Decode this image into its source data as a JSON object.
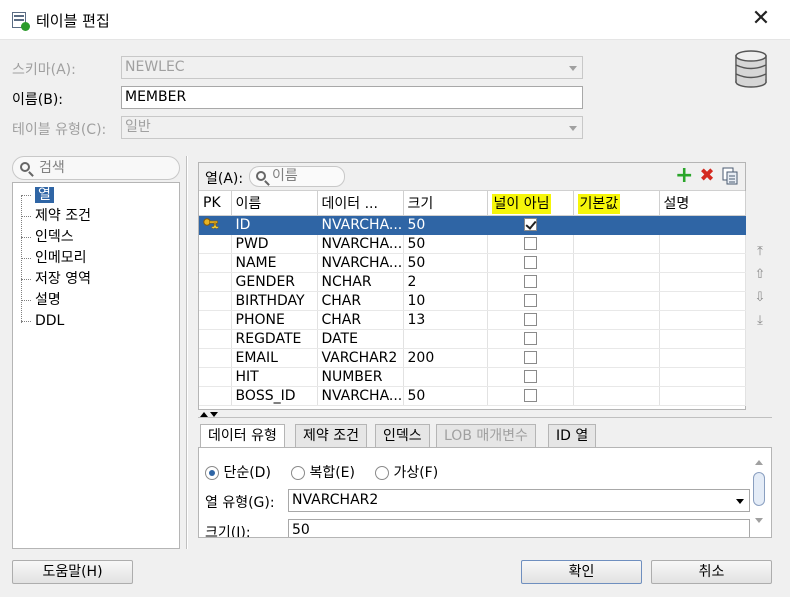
{
  "window": {
    "title": "테이블 편집"
  },
  "form": {
    "schema_label": "스키마(A):",
    "schema_value": "NEWLEC",
    "name_label": "이름(B):",
    "name_value": "MEMBER",
    "table_type_label": "테이블 유형(C):",
    "table_type_value": "일반"
  },
  "nav": {
    "search_placeholder": "검색",
    "items": [
      "열",
      "제약 조건",
      "인덱스",
      "인메모리",
      "저장 영역",
      "설명",
      "DDL"
    ],
    "selected": "열"
  },
  "columns_panel": {
    "label": "열(A):",
    "search_placeholder": "이름",
    "headers": [
      "PK",
      "이름",
      "데이터 ...",
      "크기",
      "널이 아님",
      "기본값",
      "설명"
    ],
    "highlighted_headers": [
      "널이 아님",
      "기본값"
    ],
    "rows": [
      {
        "pk": true,
        "name": "ID",
        "type": "NVARCHA...",
        "size": "50",
        "not_null": true,
        "default": "",
        "comment": ""
      },
      {
        "pk": false,
        "name": "PWD",
        "type": "NVARCHA...",
        "size": "50",
        "not_null": false,
        "default": "",
        "comment": ""
      },
      {
        "pk": false,
        "name": "NAME",
        "type": "NVARCHA...",
        "size": "50",
        "not_null": false,
        "default": "",
        "comment": ""
      },
      {
        "pk": false,
        "name": "GENDER",
        "type": "NCHAR",
        "size": "2",
        "not_null": false,
        "default": "",
        "comment": ""
      },
      {
        "pk": false,
        "name": "BIRTHDAY",
        "type": "CHAR",
        "size": "10",
        "not_null": false,
        "default": "",
        "comment": ""
      },
      {
        "pk": false,
        "name": "PHONE",
        "type": "CHAR",
        "size": "13",
        "not_null": false,
        "default": "",
        "comment": ""
      },
      {
        "pk": false,
        "name": "REGDATE",
        "type": "DATE",
        "size": "",
        "not_null": false,
        "default": "",
        "comment": ""
      },
      {
        "pk": false,
        "name": "EMAIL",
        "type": "VARCHAR2",
        "size": "200",
        "not_null": false,
        "default": "",
        "comment": ""
      },
      {
        "pk": false,
        "name": "HIT",
        "type": "NUMBER",
        "size": "",
        "not_null": false,
        "default": "",
        "comment": ""
      },
      {
        "pk": false,
        "name": "BOSS_ID",
        "type": "NVARCHA...",
        "size": "50",
        "not_null": false,
        "default": "",
        "comment": ""
      }
    ],
    "selected_row": 0
  },
  "detail_tabs": {
    "tabs": [
      {
        "label": "데이터 유형",
        "active": true,
        "disabled": false
      },
      {
        "label": "제약 조건",
        "active": false,
        "disabled": false
      },
      {
        "label": "인덱스",
        "active": false,
        "disabled": false
      },
      {
        "label": "LOB 매개변수",
        "active": false,
        "disabled": true
      },
      {
        "label": "ID 열",
        "active": false,
        "disabled": false
      }
    ],
    "radio_options": [
      "단순(D)",
      "복합(E)",
      "가상(F)"
    ],
    "radio_selected": "단순(D)",
    "column_type_label": "열 유형(G):",
    "column_type_value": "NVARCHAR2",
    "size_label": "크기(I):",
    "size_value": "50"
  },
  "buttons": {
    "help": "도움말(H)",
    "ok": "확인",
    "cancel": "취소"
  },
  "colors": {
    "selection": "#2f65a5",
    "highlight": "#f6f60a",
    "add_icon": "#2aa52a",
    "delete_icon": "#d4281e"
  }
}
